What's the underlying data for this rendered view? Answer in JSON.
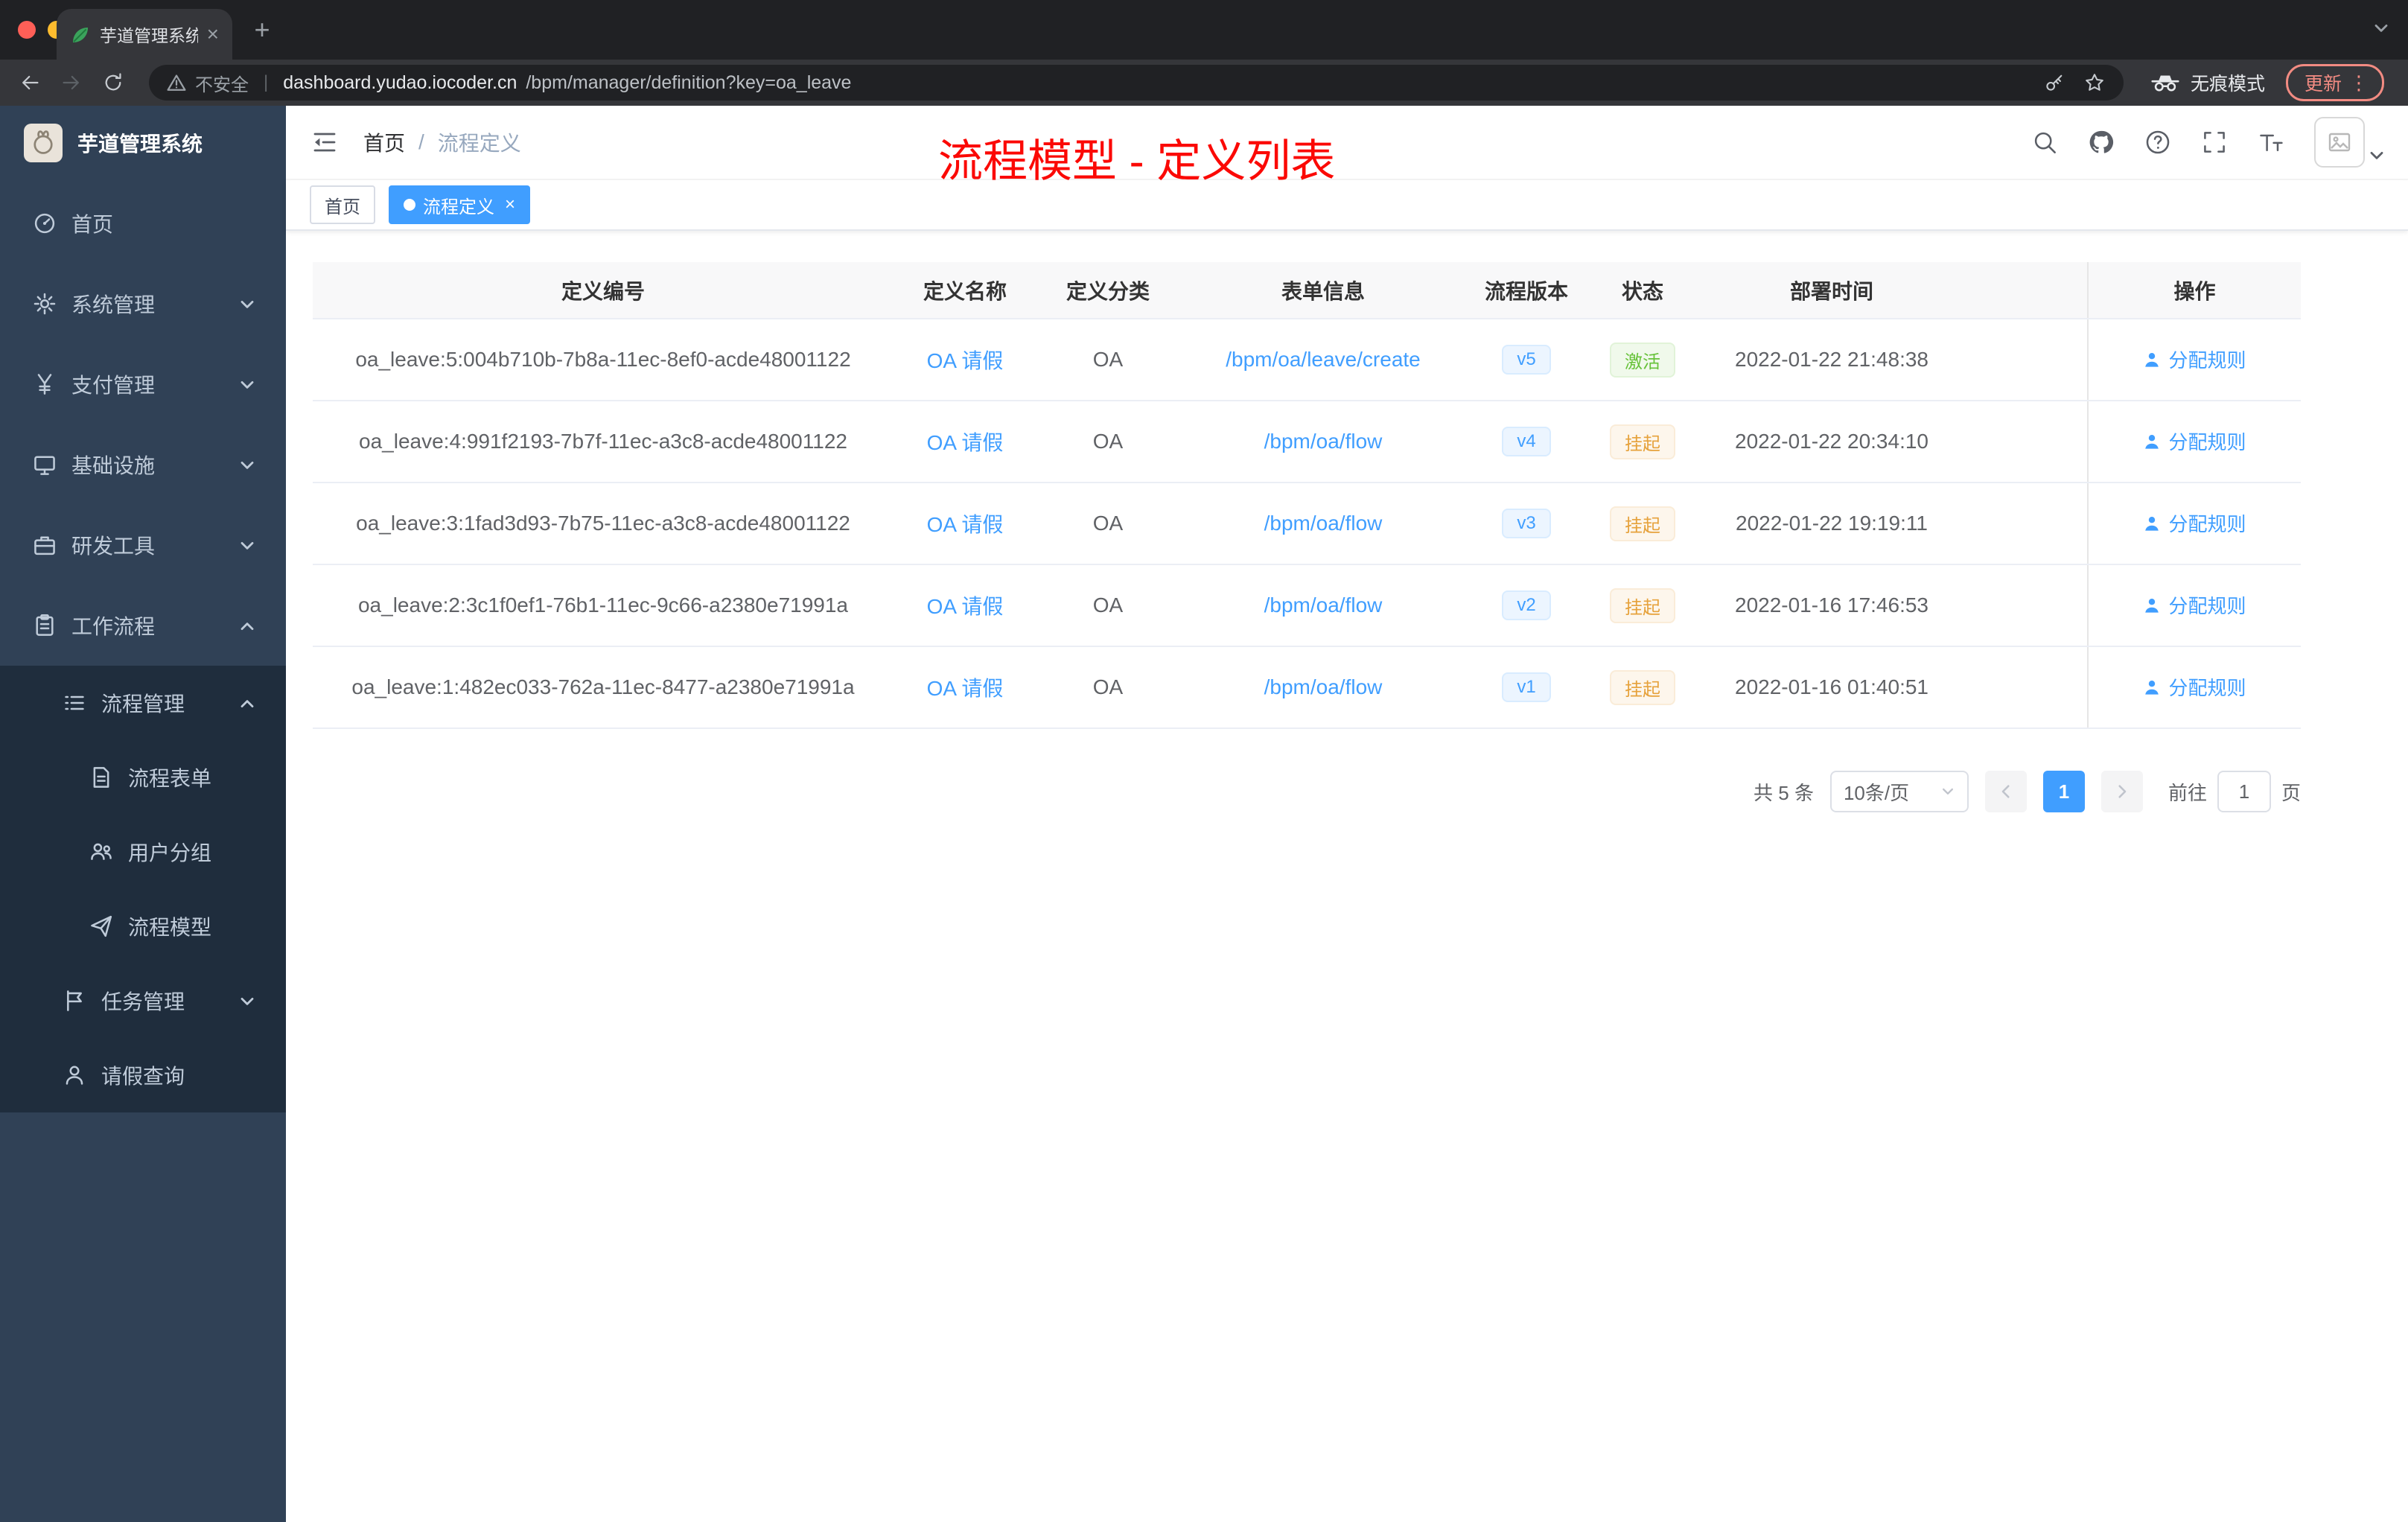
{
  "browser": {
    "tab": {
      "title": "芋道管理系统"
    },
    "security_label": "不安全",
    "url_host": "dashboard.yudao.iocoder.cn",
    "url_path": "/bpm/manager/definition?key=oa_leave",
    "incognito_label": "无痕模式",
    "update_label": "更新"
  },
  "icons": {
    "close": "×",
    "new_tab": "+",
    "more_vertical": "⋮",
    "active_tag_dot": ""
  },
  "sidebar": {
    "logo_title": "芋道管理系统",
    "items": [
      {
        "key": "home",
        "label": "首页",
        "icon": "dashboard",
        "level": 0,
        "arrow": "",
        "dark": false
      },
      {
        "key": "system",
        "label": "系统管理",
        "icon": "gear",
        "level": 0,
        "arrow": "down",
        "dark": false
      },
      {
        "key": "payment",
        "label": "支付管理",
        "icon": "yen",
        "level": 0,
        "arrow": "down",
        "dark": false
      },
      {
        "key": "infrastructure",
        "label": "基础设施",
        "icon": "monitor",
        "level": 0,
        "arrow": "down",
        "dark": false
      },
      {
        "key": "dev-tools",
        "label": "研发工具",
        "icon": "briefcase",
        "level": 0,
        "arrow": "down",
        "dark": false
      },
      {
        "key": "workflow",
        "label": "工作流程",
        "icon": "clipboard",
        "level": 0,
        "arrow": "up",
        "dark": false
      },
      {
        "key": "process-manage",
        "label": "流程管理",
        "icon": "list",
        "level": 1,
        "arrow": "up",
        "dark": true
      },
      {
        "key": "process-form",
        "label": "流程表单",
        "icon": "document",
        "level": 2,
        "arrow": "",
        "dark": true
      },
      {
        "key": "user-group",
        "label": "用户分组",
        "icon": "users",
        "level": 2,
        "arrow": "",
        "dark": true
      },
      {
        "key": "process-model",
        "label": "流程模型",
        "icon": "plane",
        "level": 2,
        "arrow": "",
        "dark": true
      },
      {
        "key": "task-manage",
        "label": "任务管理",
        "icon": "flag",
        "level": 1,
        "arrow": "down",
        "dark": true
      },
      {
        "key": "leave-query",
        "label": "请假查询",
        "icon": "person",
        "level": 1,
        "arrow": "",
        "dark": true
      }
    ]
  },
  "navbar": {
    "breadcrumb": {
      "first": "首页",
      "separator": "/",
      "current": "流程定义"
    },
    "annotation": "流程模型 - 定义列表"
  },
  "tags": [
    {
      "key": "home",
      "label": "首页",
      "active": false,
      "closable": false
    },
    {
      "key": "process-definition",
      "label": "流程定义",
      "active": true,
      "closable": true
    }
  ],
  "table": {
    "columns": [
      "定义编号",
      "定义名称",
      "定义分类",
      "表单信息",
      "流程版本",
      "状态",
      "部署时间",
      "",
      "操作"
    ],
    "rows": [
      {
        "id": "oa_leave:5:004b710b-7b8a-11ec-8ef0-acde48001122",
        "name": "OA 请假",
        "category": "OA",
        "form": "/bpm/oa/leave/create",
        "version": "v5",
        "status": "激活",
        "status_type": "success",
        "time": "2022-01-22 21:48:38",
        "action": "分配规则"
      },
      {
        "id": "oa_leave:4:991f2193-7b7f-11ec-a3c8-acde48001122",
        "name": "OA 请假",
        "category": "OA",
        "form": "/bpm/oa/flow",
        "version": "v4",
        "status": "挂起",
        "status_type": "warning",
        "time": "2022-01-22 20:34:10",
        "action": "分配规则"
      },
      {
        "id": "oa_leave:3:1fad3d93-7b75-11ec-a3c8-acde48001122",
        "name": "OA 请假",
        "category": "OA",
        "form": "/bpm/oa/flow",
        "version": "v3",
        "status": "挂起",
        "status_type": "warning",
        "time": "2022-01-22 19:19:11",
        "action": "分配规则"
      },
      {
        "id": "oa_leave:2:3c1f0ef1-76b1-11ec-9c66-a2380e71991a",
        "name": "OA 请假",
        "category": "OA",
        "form": "/bpm/oa/flow",
        "version": "v2",
        "status": "挂起",
        "status_type": "warning",
        "time": "2022-01-16 17:46:53",
        "action": "分配规则"
      },
      {
        "id": "oa_leave:1:482ec033-762a-11ec-8477-a2380e71991a",
        "name": "OA 请假",
        "category": "OA",
        "form": "/bpm/oa/flow",
        "version": "v1",
        "status": "挂起",
        "status_type": "warning",
        "time": "2022-01-16 01:40:51",
        "action": "分配规则"
      }
    ]
  },
  "pagination": {
    "total": "共 5 条",
    "page_size": "10条/页",
    "current_page": "1",
    "goto_label": "前往",
    "goto_value": "1",
    "page_unit": "页"
  },
  "colors": {
    "accent": "#409EFF",
    "success": "#67C23A",
    "warning": "#E6A23C",
    "annotation_red": "#FB0905",
    "sidebar_bg": "#304156",
    "sidebar_sub_bg": "#1F2D3D"
  }
}
